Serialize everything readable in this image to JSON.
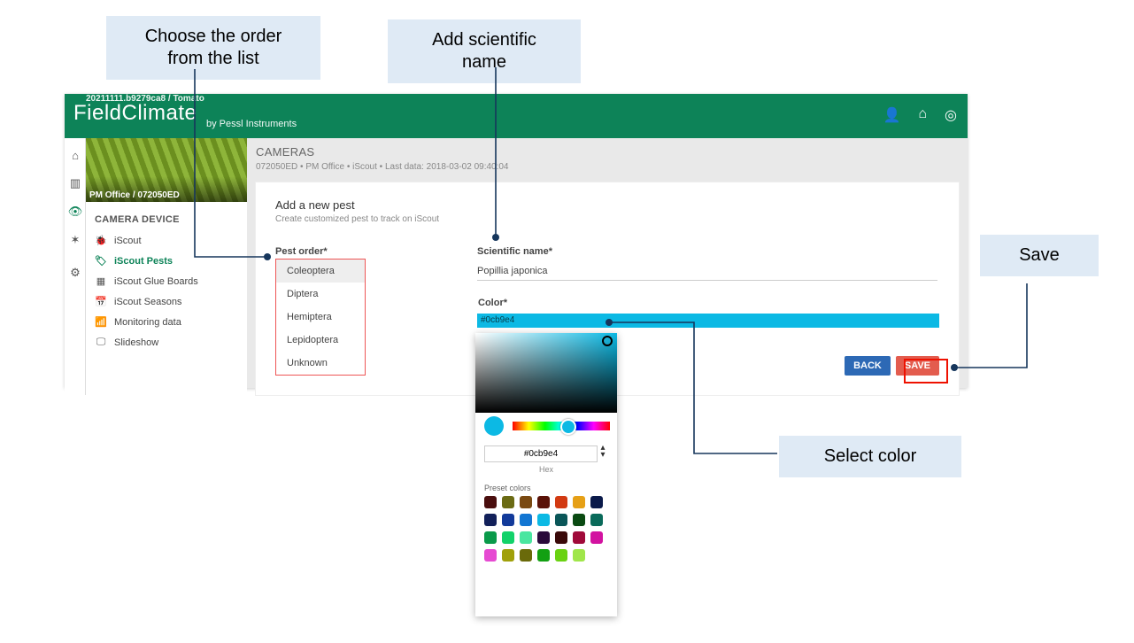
{
  "annotations": {
    "order": "Choose the order from the list",
    "sci": "Add scientific name",
    "save": "Save",
    "color": "Select color"
  },
  "app": {
    "crumb": "20211111.b9279ca8 / Tomato",
    "logo": "FieldClimate",
    "byline": "by Pessl Instruments",
    "thumb_label": "PM Office / 072050ED"
  },
  "rail": [
    "home-icon",
    "chart-icon",
    "eye-icon",
    "spray-icon",
    "gear-icon"
  ],
  "side": {
    "header": "CAMERA DEVICE",
    "items": [
      {
        "icon": "🐞",
        "label": "iScout"
      },
      {
        "icon": "🏷",
        "label": "iScout Pests",
        "selected": true
      },
      {
        "icon": "▦",
        "label": "iScout Glue Boards"
      },
      {
        "icon": "📅",
        "label": "iScout Seasons"
      },
      {
        "icon": "📶",
        "label": "Monitoring data"
      },
      {
        "icon": "🖵",
        "label": "Slideshow"
      }
    ]
  },
  "header": {
    "t1": "CAMERAS",
    "t2": "072050ED • PM Office • iScout • Last data: 2018-03-02 09:40:04"
  },
  "form": {
    "title": "Add a new pest",
    "sub": "Create customized pest to track on iScout",
    "order_label": "Pest order*",
    "sci_label": "Scientific name*",
    "color_label": "Color*",
    "sci_value": "Popillia japonica",
    "color_value": "#0cb9e4",
    "back": "BACK",
    "save": "SAVE",
    "options": [
      "Coleoptera",
      "Diptera",
      "Hemiptera",
      "Lepidoptera",
      "Unknown"
    ]
  },
  "picker": {
    "hex": "#0cb9e4",
    "hex_label": "Hex",
    "preset_label": "Preset colors",
    "presets": [
      "#4a0e0e",
      "#6b6b14",
      "#7a4a12",
      "#5a1208",
      "#d23a12",
      "#e6a016",
      "#0a1a4a",
      "#12205a",
      "#123a9a",
      "#1276d2",
      "#0cb9e4",
      "#0a5658",
      "#0a4a12",
      "#0a6a5a",
      "#0a9a4a",
      "#12d26a",
      "#4ae6a0",
      "#2a0a3a",
      "#3a0a0a",
      "#a00a3a",
      "#d212a0",
      "#e64ad2",
      "#a0a00a",
      "#6a6a0a",
      "#12a012",
      "#6ad212",
      "#a0e64a"
    ]
  }
}
